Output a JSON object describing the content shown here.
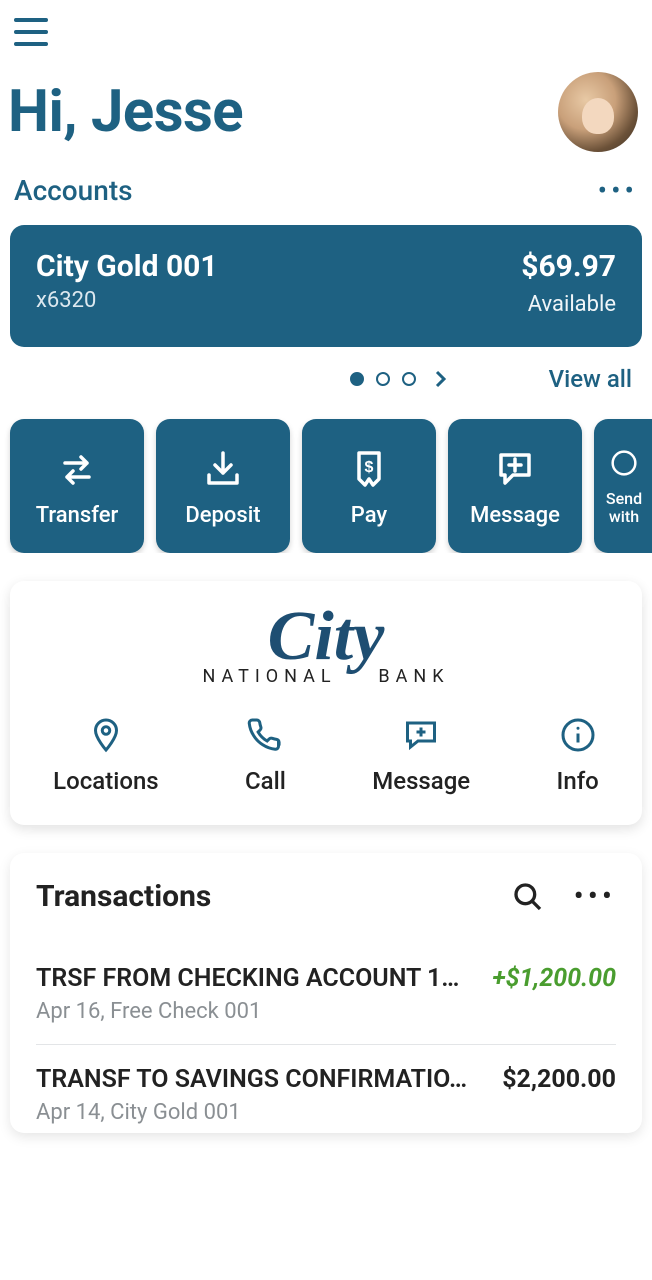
{
  "brand_color": "#1e6182",
  "header": {
    "greeting": "Hi, Jesse"
  },
  "accounts_section": {
    "title": "Accounts",
    "view_all": "View all",
    "page_count": 3,
    "active_page": 1
  },
  "account_card": {
    "name": "City Gold 001",
    "masked": "x6320",
    "balance": "$69.97",
    "balance_label": "Available"
  },
  "quick_actions": [
    {
      "id": "transfer",
      "label": "Transfer",
      "icon": "transfer-icon"
    },
    {
      "id": "deposit",
      "label": "Deposit",
      "icon": "deposit-icon"
    },
    {
      "id": "pay",
      "label": "Pay",
      "icon": "pay-icon"
    },
    {
      "id": "message",
      "label": "Message",
      "icon": "message-plus-icon"
    },
    {
      "id": "send",
      "label": "Send with",
      "icon": "send-icon"
    }
  ],
  "bank_panel": {
    "logo_main": "City",
    "logo_sub": "NATIONAL BANK",
    "actions": [
      {
        "id": "locations",
        "label": "Locations",
        "icon": "pin-icon"
      },
      {
        "id": "call",
        "label": "Call",
        "icon": "phone-icon"
      },
      {
        "id": "message",
        "label": "Message",
        "icon": "message-plus-icon"
      },
      {
        "id": "info",
        "label": "Info",
        "icon": "info-icon"
      }
    ]
  },
  "transactions": {
    "title": "Transactions",
    "items": [
      {
        "desc": "TRSF FROM CHECKING ACCOUNT 1…",
        "amount": "+$1,200.00",
        "positive": true,
        "sub": "Apr 16, Free Check 001"
      },
      {
        "desc": "TRANSF TO SAVINGS CONFIRMATIO…",
        "amount": "$2,200.00",
        "positive": false,
        "sub": "Apr 14, City Gold 001"
      }
    ]
  }
}
